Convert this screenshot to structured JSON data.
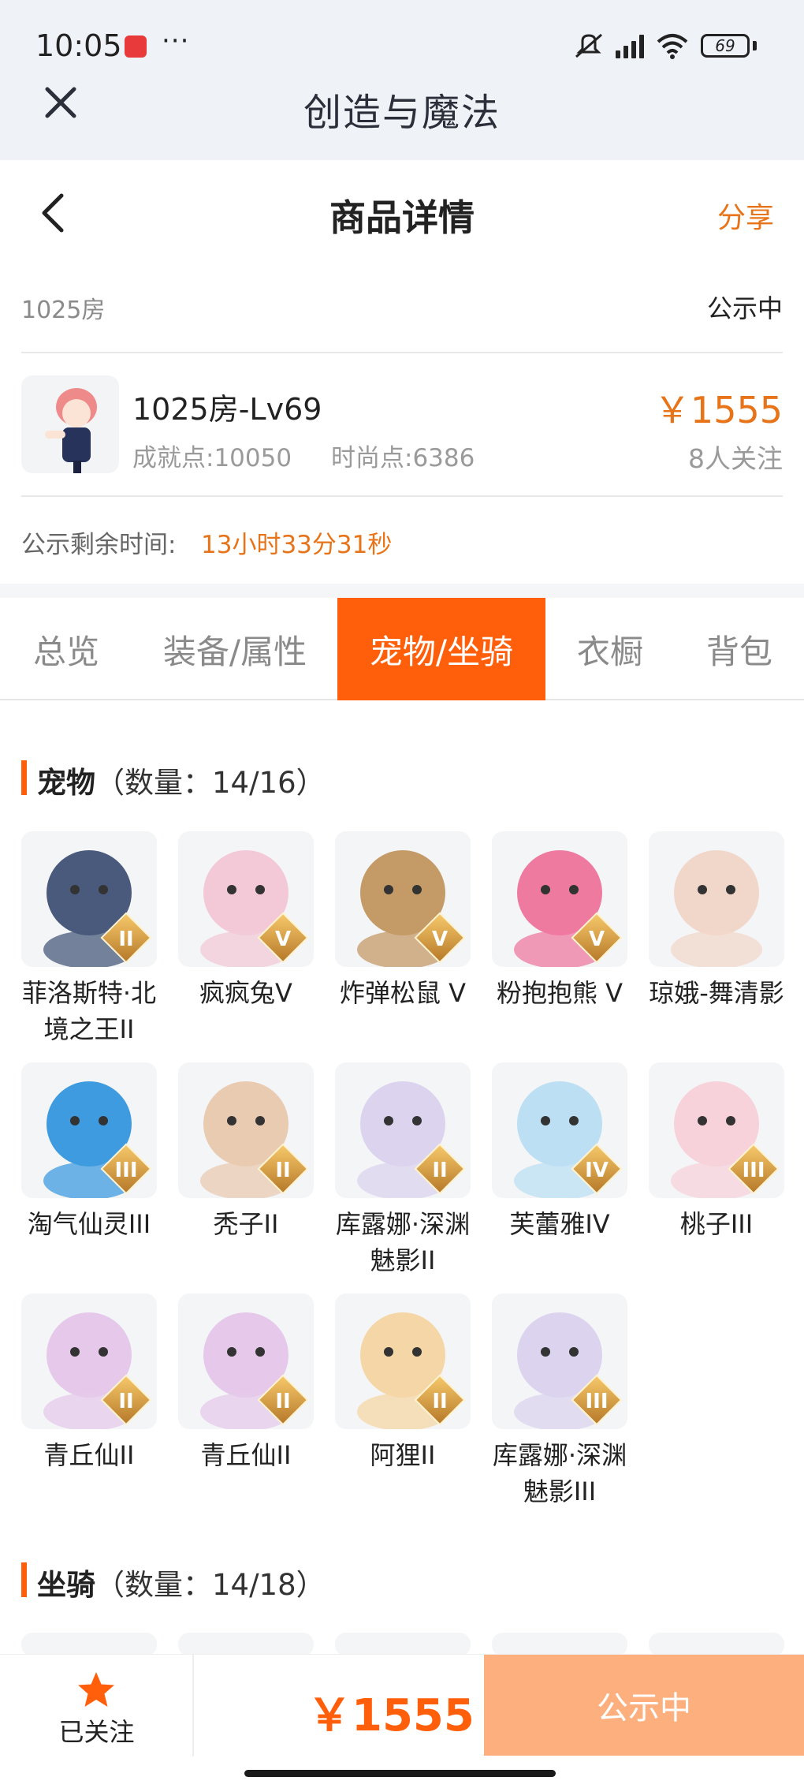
{
  "status_bar": {
    "time": "10:05",
    "dots": "···",
    "battery": "69"
  },
  "app": {
    "title": "创造与魔法"
  },
  "header": {
    "title": "商品详情",
    "share": "分享"
  },
  "listing": {
    "room": "1025房",
    "status": "公示中",
    "name": "1025房-Lv69",
    "achievement": "成就点:10050",
    "fashion": "时尚点:6386",
    "price": "￥1555",
    "followers": "8人关注",
    "remain_label": "公示剩余时间:",
    "remain_time": "13小时33分31秒"
  },
  "tabs": [
    "总览",
    "装备/属性",
    "宠物/坐骑",
    "衣橱",
    "背包"
  ],
  "active_tab": "宠物/坐骑",
  "pets_section": {
    "title": "宠物",
    "count": "（数量：14/16）"
  },
  "pets": [
    {
      "name": "菲洛斯特·北境之王II",
      "rank": "II",
      "color": "#4a5a7c"
    },
    {
      "name": "疯疯兔V",
      "rank": "V",
      "color": "#f3c9d8"
    },
    {
      "name": "炸弹松鼠 V",
      "rank": "V",
      "color": "#c49a67"
    },
    {
      "name": "粉抱抱熊 V",
      "rank": "V",
      "color": "#ef7aa0"
    },
    {
      "name": "琼娥-舞清影",
      "rank": "",
      "color": "#f1d7c9"
    },
    {
      "name": "淘气仙灵III",
      "rank": "III",
      "color": "#3f9be0"
    },
    {
      "name": "秃子II",
      "rank": "II",
      "color": "#e9cbb2"
    },
    {
      "name": "库露娜·深渊魅影II",
      "rank": "II",
      "color": "#dcd3ef"
    },
    {
      "name": "芙蕾雅IV",
      "rank": "IV",
      "color": "#bcdff3"
    },
    {
      "name": "桃子III",
      "rank": "III",
      "color": "#f7d2db"
    },
    {
      "name": "青丘仙II",
      "rank": "II",
      "color": "#e6c9ea"
    },
    {
      "name": "青丘仙II",
      "rank": "II",
      "color": "#e6c9ea"
    },
    {
      "name": "阿狸II",
      "rank": "II",
      "color": "#f5d6a6"
    },
    {
      "name": "库露娜·深渊魅影III",
      "rank": "III",
      "color": "#dcd3ef"
    }
  ],
  "mounts_section": {
    "title": "坐骑",
    "count": "（数量：14/18）"
  },
  "bottom": {
    "follow_label": "已关注",
    "price": "￥1555",
    "button": "公示中"
  },
  "colors": {
    "accent": "#ff5e0a",
    "price": "#e8741a",
    "button": "#fdaf7d"
  }
}
